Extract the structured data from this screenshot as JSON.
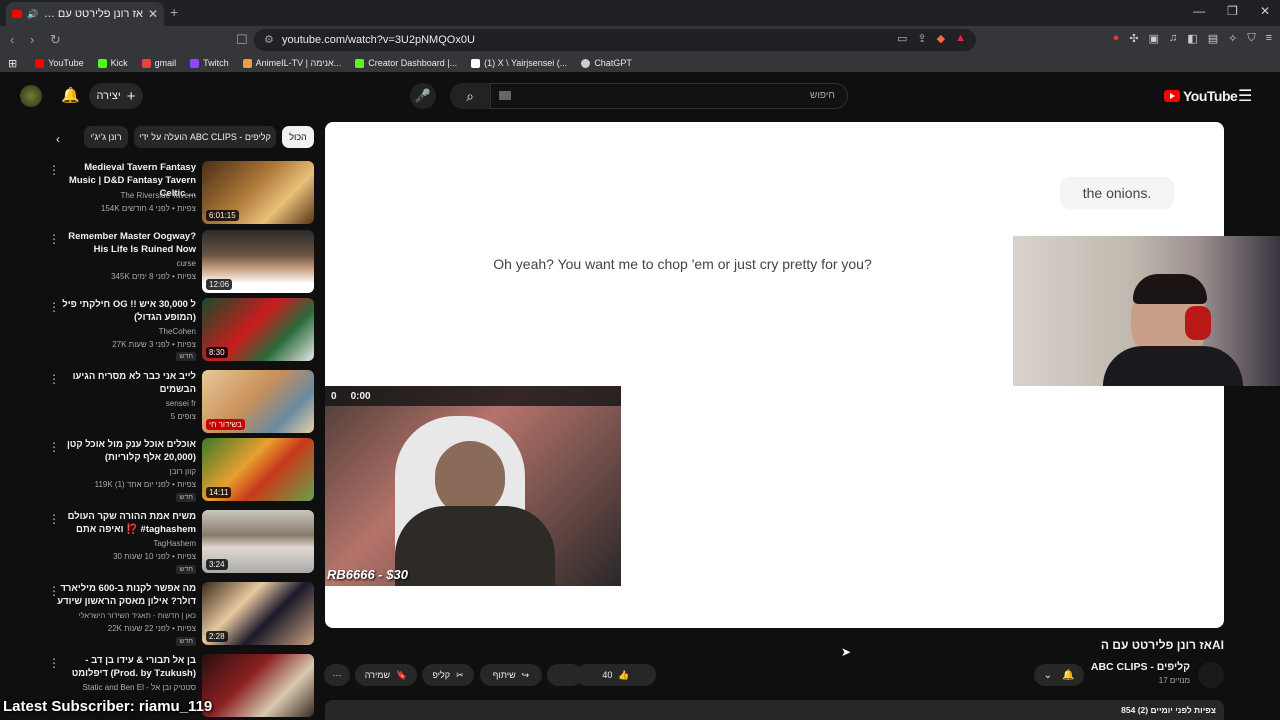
{
  "browser": {
    "tab_title": "אז רונן פלירטט עם הAI - YouTube",
    "url": "youtube.com/watch?v=3U2pNMQOx0U",
    "window_controls": [
      "—",
      "❐",
      "✕"
    ]
  },
  "bookmarks": [
    {
      "label": "YouTube",
      "color": "#ff0000"
    },
    {
      "label": "Kick",
      "color": "#53fc18"
    },
    {
      "label": "gmail",
      "color": "#ea4335"
    },
    {
      "label": "Twitch",
      "color": "#9146ff"
    },
    {
      "label": "AnimeIL-TV | אנימה...",
      "color": "#e6a23c"
    },
    {
      "label": "Creator Dashboard |...",
      "color": "#53fc18"
    },
    {
      "label": "(1) X \\ Yairjsensei (...",
      "color": "#ffffff"
    },
    {
      "label": "ChatGPT",
      "color": "#cccccc"
    }
  ],
  "header": {
    "create_label": "יצירה",
    "search_placeholder": "חיפוש",
    "logo_text": "YouTube"
  },
  "chips": {
    "all": "הכול",
    "uploaded_by": "הועלה על ידי ABC CLIPS - קליפים",
    "ronen": "רונן ג'יג'י"
  },
  "recommendations": [
    {
      "title": "Medieval Tavern Fantasy Music | D&D Fantasy Tavern Celtic ...",
      "channel": "The Riverside Tavern",
      "meta": "154K צפיות • לפני 4 חודשים",
      "duration": "6:01:15",
      "badge": ""
    },
    {
      "title": "Remember Master Oogway? His Life Is Ruined Now",
      "channel": "curse",
      "meta": "345K צפיות • לפני 8 ימים",
      "duration": "12:06",
      "badge": ""
    },
    {
      "title": "חילקתי פיל OG ל 30,000 איש !! (המופע הגדול)",
      "channel": "TheCohen",
      "meta": "27K צפיות • לפני 3 שעות",
      "duration": "8:30",
      "badge": "חדש"
    },
    {
      "title": "לייב אני כבר לא מסריח הגיעו הבשמים",
      "channel": "sensei fr",
      "meta": "5 צופים",
      "duration": "",
      "badge": "בשידור חי"
    },
    {
      "title": "אוכלים אוכל ענק מול אוכל קטן (20,000 אלף קלוריות)",
      "channel": "קוון רובן",
      "meta": "119K צפיות • לפני יום אחד (1)",
      "duration": "14:11",
      "badge": "חדש"
    },
    {
      "title": "משיח אמת ההורה שקר העולם ואיפה אתם ⁉️ #taghashem",
      "channel": "TagHashem",
      "meta": "30 צפיות • לפני 10 שעות",
      "duration": "3:24",
      "badge": "חדש"
    },
    {
      "title": "מה אפשר לקנות ב-600 מיליארד דולר? אילון מאסק הראשון שיודע",
      "channel": "כאן | חדשות - תאגיד השידור הישראלי",
      "meta": "22K צפיות • לפני 22 שעות",
      "duration": "2:28",
      "badge": "חדש"
    },
    {
      "title": "בן אל תבורי & עידו בן דב - דיפלומט (Prod. by Tzukush)",
      "channel": "Static and Ben El - סטטיק ובן אל",
      "meta": "",
      "duration": "",
      "badge": ""
    }
  ],
  "player": {
    "bubble_text": "the onions.",
    "ai_text": "Oh yeah? You want me to chop 'em or just cry pretty for you?",
    "hud_left": "0",
    "hud_time": "0:00",
    "donation": "RB6666 - $30"
  },
  "video": {
    "title": "אז רונן פלירטט עם הAI",
    "channel": "ABC CLIPS - קליפים",
    "subscribers": "17 מנויים",
    "likes": "40",
    "share": "שיתוף",
    "clip": "קליפ",
    "save": "שמירה",
    "more": "···",
    "views_meta": "854 צפיות  לפני יומיים (2)"
  },
  "overlay": {
    "latest_sub": "Latest Subscriber: riamu_119"
  },
  "colors": {
    "accent": "#ff0000",
    "background": "#0f0f0f",
    "chip_bg": "#272727"
  }
}
